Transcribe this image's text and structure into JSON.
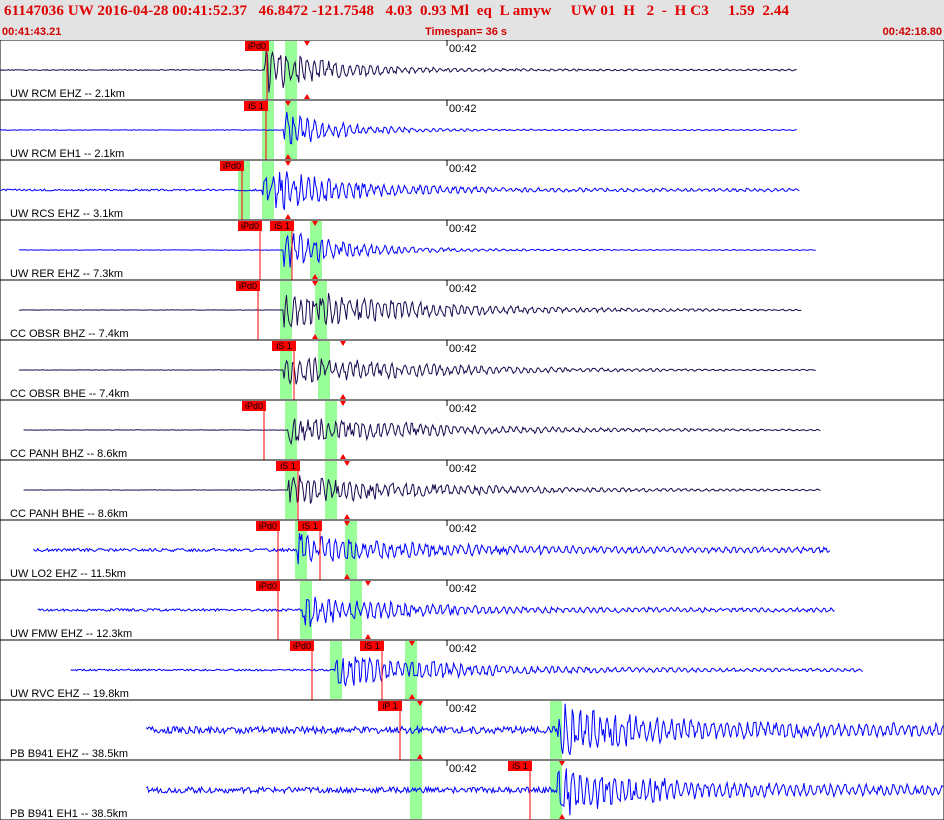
{
  "header": {
    "title": "61147036 UW 2016-04-28 00:41:52.37   46.8472 -121.7548   4.03  0.93 Ml  eq  L amyw     UW 01  H   2  -  H C3     1.59  2.44",
    "start_time": "00:41:43.21",
    "timespan": "Timespan=  36 s",
    "end_time": "00:42:18.80"
  },
  "minute_label": "00:42",
  "colors": {
    "trace": "#0000ff",
    "trace_dark": "#1a0a50",
    "pick_box": "#ff0000",
    "pick_band": "#99ff99",
    "header_bg": "#e3e3e3",
    "header_text": "#e00000"
  },
  "panels": [
    {
      "label": "UW RCM EHZ -- 2.1km",
      "picks": [
        {
          "label": "iPd0",
          "kind": "P"
        }
      ],
      "trace": {
        "start": 0,
        "end": 0.845,
        "onset": 0.28,
        "amp": 0.8,
        "noise": 0.015,
        "decay": 8,
        "color": "dark"
      }
    },
    {
      "label": "UW RCM EH1 -- 2.1km",
      "picks": [
        {
          "label": "iS 1",
          "kind": "S"
        }
      ],
      "trace": {
        "start": 0,
        "end": 0.845,
        "onset": 0.3,
        "amp": 0.65,
        "noise": 0.01,
        "decay": 9,
        "color": "blue"
      }
    },
    {
      "label": "UW RCS EHZ -- 3.1km",
      "picks": [
        {
          "label": "iPd0",
          "kind": "P"
        }
      ],
      "trace": {
        "start": 0,
        "end": 0.847,
        "onset": 0.278,
        "amp": 0.85,
        "noise": 0.03,
        "decay": 7,
        "color": "blue"
      }
    },
    {
      "label": "UW RER EHZ -- 7.3km",
      "picks": [
        {
          "label": "iPd0",
          "kind": "P"
        },
        {
          "label": "iS 1",
          "kind": "S"
        }
      ],
      "trace": {
        "start": 0.02,
        "end": 0.865,
        "onset": 0.3,
        "amp": 0.7,
        "noise": 0.008,
        "decay": 8,
        "color": "blue"
      }
    },
    {
      "label": "CC OBSR BHZ -- 7.4km",
      "picks": [
        {
          "label": "iPd0",
          "kind": "P"
        }
      ],
      "trace": {
        "start": 0.02,
        "end": 0.85,
        "onset": 0.3,
        "amp": 0.8,
        "noise": 0.006,
        "decay": 4,
        "color": "dark"
      }
    },
    {
      "label": "CC OBSR BHE -- 7.4km",
      "picks": [
        {
          "label": "iS 1",
          "kind": "S"
        }
      ],
      "trace": {
        "start": 0.02,
        "end": 0.865,
        "onset": 0.3,
        "amp": 0.6,
        "noise": 0.006,
        "decay": 4,
        "color": "dark"
      }
    },
    {
      "label": "CC PANH BHZ -- 8.6km",
      "picks": [
        {
          "label": "iPd0",
          "kind": "P"
        }
      ],
      "trace": {
        "start": 0.025,
        "end": 0.87,
        "onset": 0.305,
        "amp": 0.55,
        "noise": 0.006,
        "decay": 3.5,
        "color": "dark"
      }
    },
    {
      "label": "CC PANH BHE -- 8.6km",
      "picks": [
        {
          "label": "iS 1",
          "kind": "S"
        }
      ],
      "trace": {
        "start": 0.025,
        "end": 0.87,
        "onset": 0.305,
        "amp": 0.55,
        "noise": 0.006,
        "decay": 3.5,
        "color": "dark"
      }
    },
    {
      "label": "UW LO2 EHZ -- 11.5km",
      "picks": [
        {
          "label": "iPd0",
          "kind": "P"
        },
        {
          "label": "iS 1",
          "kind": "S"
        }
      ],
      "trace": {
        "start": 0.035,
        "end": 0.88,
        "onset": 0.315,
        "amp": 0.55,
        "noise": 0.05,
        "decay": 5,
        "color": "blue"
      }
    },
    {
      "label": "UW FMW EHZ -- 12.3km",
      "picks": [
        {
          "label": "iPd0",
          "kind": "P"
        }
      ],
      "trace": {
        "start": 0.04,
        "end": 0.885,
        "onset": 0.32,
        "amp": 0.6,
        "noise": 0.04,
        "decay": 6,
        "color": "blue"
      }
    },
    {
      "label": "UW RVC EHZ -- 19.8km",
      "picks": [
        {
          "label": "iPd0",
          "kind": "P"
        },
        {
          "label": "iS 1",
          "kind": "S"
        }
      ],
      "trace": {
        "start": 0.075,
        "end": 0.915,
        "onset": 0.355,
        "amp": 0.6,
        "noise": 0.03,
        "decay": 5,
        "color": "blue"
      }
    },
    {
      "label": "PB B941 EHZ -- 38.5km",
      "picks": [
        {
          "label": "iP 1",
          "kind": "P"
        }
      ],
      "trace": {
        "start": 0.155,
        "end": 1,
        "onset": 0.59,
        "amp": 0.85,
        "noise": 0.12,
        "decay": 5,
        "color": "blue"
      }
    },
    {
      "label": "PB B941 EH1 -- 38.5km",
      "picks": [
        {
          "label": "iS 1",
          "kind": "S"
        }
      ],
      "trace": {
        "start": 0.155,
        "end": 1,
        "onset": 0.59,
        "amp": 0.8,
        "noise": 0.1,
        "decay": 5,
        "color": "blue"
      }
    }
  ]
}
